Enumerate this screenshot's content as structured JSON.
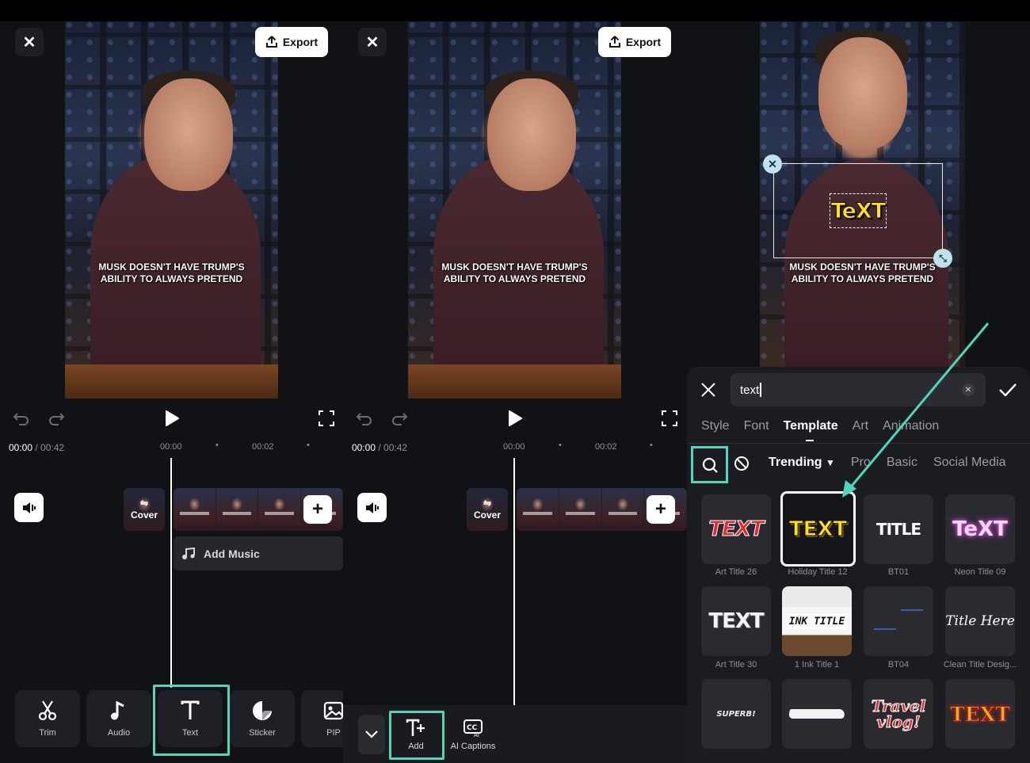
{
  "editor": {
    "export_label": "Export",
    "caption_line1": "MUSK DOESN'T HAVE TRUMP'S",
    "caption_line2": "ABILITY TO ALWAYS PRETEND",
    "timecode_current": "00:00",
    "timecode_total": " / 00:42",
    "ruler": [
      "00:00",
      "00:02"
    ],
    "cover_label": "Cover",
    "add_music_label": "Add Music"
  },
  "toolbar": {
    "items": [
      {
        "label": "Trim",
        "icon": "scissors-icon"
      },
      {
        "label": "Audio",
        "icon": "music-note-icon"
      },
      {
        "label": "Text",
        "icon": "text-icon"
      },
      {
        "label": "Sticker",
        "icon": "sticker-icon"
      },
      {
        "label": "PIP",
        "icon": "image-icon"
      }
    ]
  },
  "text_menu": {
    "add_label": "Add",
    "ai_captions_label": "AI Captions"
  },
  "template_panel": {
    "overlay_text": "TeXT",
    "search_value": "text",
    "tabs": [
      "Style",
      "Font",
      "Template",
      "Art",
      "Animation"
    ],
    "active_tab": "Template",
    "categories": [
      "Trending",
      "Pro",
      "Basic",
      "Social Media"
    ],
    "active_category": "Trending",
    "templates": [
      {
        "preview": "TEXT",
        "label": "Art Title 26"
      },
      {
        "preview": "TEXT",
        "label": "Holiday Title 12",
        "selected": true
      },
      {
        "preview": "TITLE",
        "label": "BT01"
      },
      {
        "preview": "TeXT",
        "label": "Neon Title 09"
      },
      {
        "preview": "TEXT",
        "label": "Art Title 30"
      },
      {
        "preview": "INK TITLE",
        "label": "1 Ink Title 1"
      },
      {
        "preview": "",
        "label": "BT04"
      },
      {
        "preview": "Title Here",
        "label": "Clean Title Desig..."
      },
      {
        "preview": "SUPERB!",
        "label": ""
      },
      {
        "preview": "",
        "label": ""
      },
      {
        "preview": "Travel vlog!",
        "label": ""
      },
      {
        "preview": "TEXT",
        "label": ""
      }
    ]
  },
  "colors": {
    "highlight": "#4fd6bb",
    "holiday_yellow": "#ffe01a",
    "art_red": "#e8262b",
    "neon_pink": "#d34bd6"
  }
}
